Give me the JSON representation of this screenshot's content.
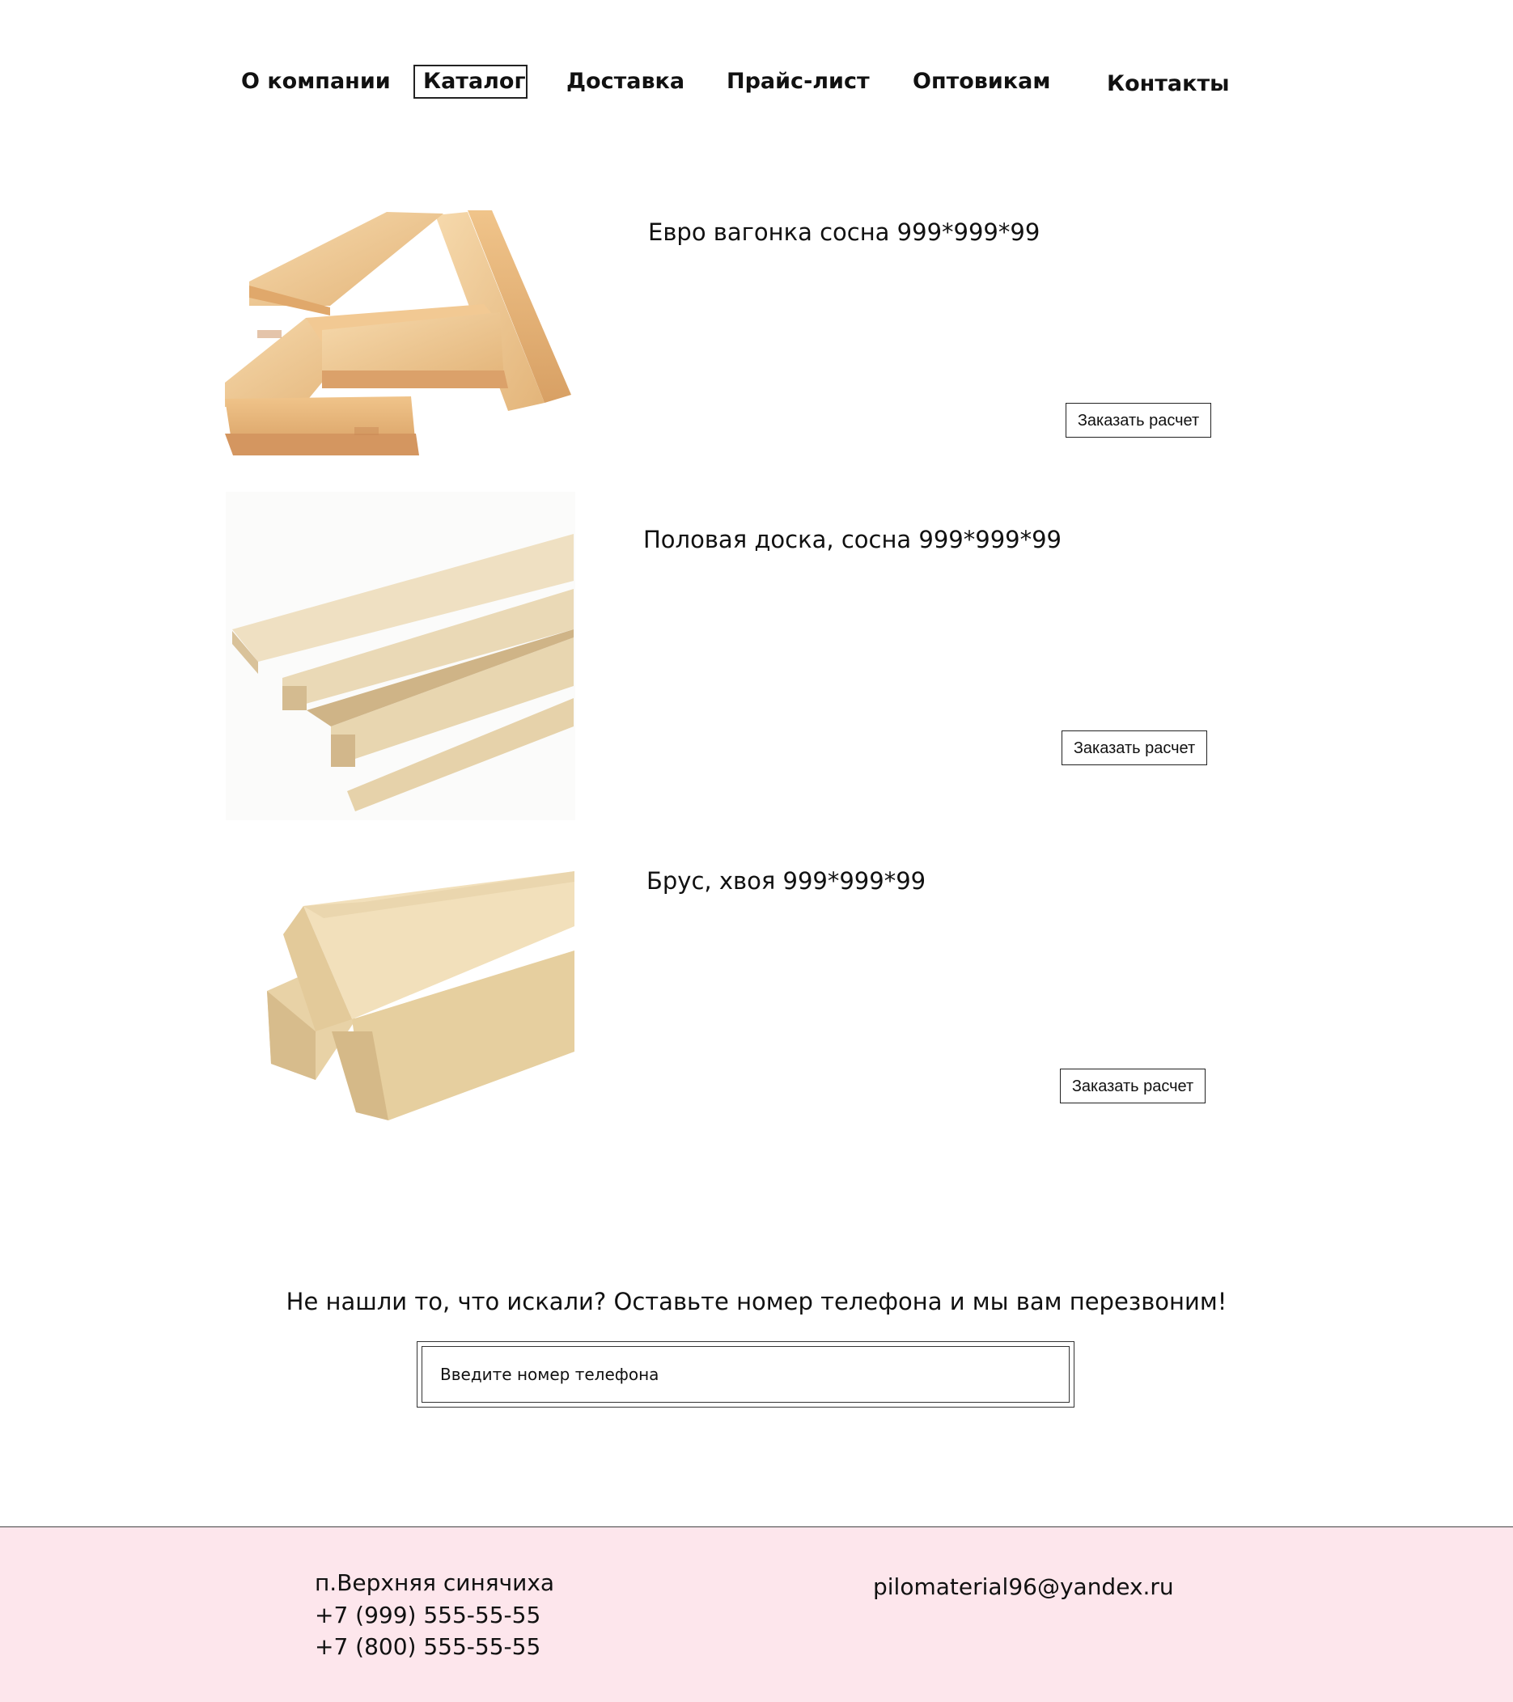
{
  "nav": {
    "items": [
      {
        "label": "О компании"
      },
      {
        "label": "Каталог",
        "active": true
      },
      {
        "label": "Доставка"
      },
      {
        "label": "Прайс-лист"
      },
      {
        "label": "Оптовикам"
      },
      {
        "label": "Контакты"
      }
    ]
  },
  "catalog": {
    "products": [
      {
        "title": "Евро вагонка сосна 999*999*99",
        "button": "Заказать расчет",
        "image": "tongue-and-groove-boards"
      },
      {
        "title": "Половая доска, сосна 999*999*99",
        "button": "Заказать расчет",
        "image": "floor-boards"
      },
      {
        "title": "Брус, хвоя 999*999*99",
        "button": "Заказать расчет",
        "image": "timber-beams"
      }
    ]
  },
  "callback": {
    "text": "Не нашли то, что искали? Оставьте номер телефона и мы вам перезвоним!",
    "placeholder": "Введите номер телефона"
  },
  "footer": {
    "address": "п.Верхняя синячиха",
    "phone1": "+7 (999) 555-55-55",
    "phone2": "+7 (800) 555-55-55",
    "email": "pilomaterial96@yandex.ru",
    "background": "#fde6ec"
  }
}
